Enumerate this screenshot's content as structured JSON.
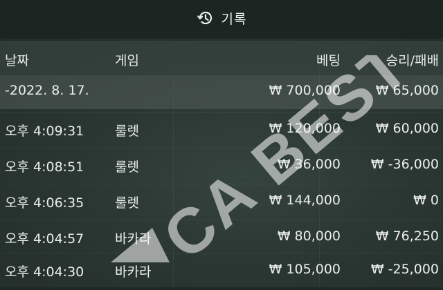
{
  "header": {
    "title": "기록",
    "icon": "history-icon"
  },
  "columns": {
    "date": "날짜",
    "game": "게임",
    "bet": "베팅",
    "result": "승리/패배"
  },
  "summary": {
    "date": "-2022. 8. 17.",
    "game": "",
    "bet": "₩ 700,000",
    "result": "₩ 65,000"
  },
  "rows": [
    {
      "date": "오후 4:09:31",
      "game": "룰렛",
      "bet": "₩ 120,000",
      "result": "₩ 60,000"
    },
    {
      "date": "오후 4:08:51",
      "game": "룰렛",
      "bet": "₩ 36,000",
      "result": "₩ -36,000"
    },
    {
      "date": "오후 4:06:35",
      "game": "룰렛",
      "bet": "₩ 144,000",
      "result": "₩ 0"
    },
    {
      "date": "오후 4:04:57",
      "game": "바카라",
      "bet": "₩ 80,000",
      "result": "₩ 76,250"
    },
    {
      "date": "오후 4:04:30",
      "game": "바카라",
      "bet": "₩ 105,000",
      "result": "₩ -25,000"
    }
  ],
  "watermark": {
    "text": "CA BEST"
  },
  "colors": {
    "background": "#1f2a26",
    "header_bg": "#3c4844",
    "summary_bg": "#5a6662",
    "text": "#ecefee"
  }
}
